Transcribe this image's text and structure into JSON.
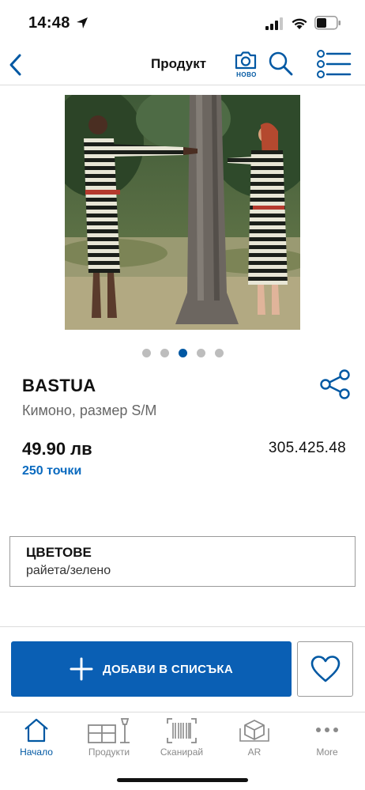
{
  "status": {
    "time": "14:48"
  },
  "header": {
    "title": "Продукт",
    "camera_badge": "НОВО"
  },
  "product": {
    "name": "BASTUA",
    "description": "Кимоно, размер S/M",
    "price": "49.90 лв",
    "points": "250 точки",
    "article_number": "305.425.48",
    "image_icon": "product-photo",
    "carousel": {
      "count": 5,
      "active_index": 2
    }
  },
  "color_section": {
    "title": "ЦВЕТОВЕ",
    "value": "райета/зелено"
  },
  "actions": {
    "add_label": "ДОБАВИ В СПИСЪКА"
  },
  "tabbar": {
    "items": [
      {
        "label": "Начало",
        "icon": "home-icon",
        "active": true
      },
      {
        "label": "Продукти",
        "icon": "products-icon",
        "active": false
      },
      {
        "label": "Сканирай",
        "icon": "barcode-icon",
        "active": false
      },
      {
        "label": "AR",
        "icon": "ar-icon",
        "active": false
      },
      {
        "label": "More",
        "icon": "more-icon",
        "active": false
      }
    ]
  },
  "colors": {
    "accent": "#0058a3",
    "button": "#0a5fb4",
    "points": "#0a6abf"
  }
}
